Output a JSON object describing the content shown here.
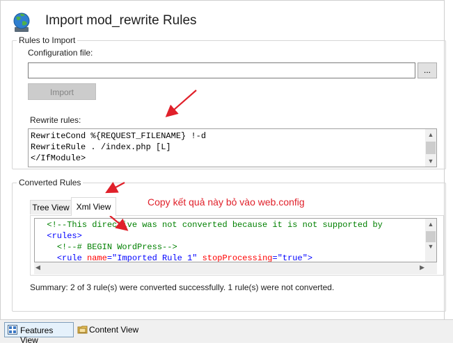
{
  "header": {
    "title": "Import mod_rewrite Rules",
    "icon": "globe-icon"
  },
  "rules_to_import": {
    "legend": "Rules to Import",
    "config_label": "Configuration file:",
    "config_value": "",
    "browse_label": "...",
    "import_label": "Import",
    "rewrite_label": "Rewrite rules:",
    "rewrite_lines": [
      "RewriteCond %{REQUEST_FILENAME} !-d",
      "RewriteRule . /index.php [L]",
      "</IfModule>"
    ]
  },
  "converted_rules": {
    "legend": "Converted Rules",
    "tabs": [
      {
        "label": "Tree View"
      },
      {
        "label": "Xml View"
      }
    ],
    "active_tab": "Xml View",
    "xml_lines": [
      {
        "indent": "  ",
        "parts": [
          {
            "t": "<!--This directive was not converted because it is not supported by",
            "c": "cmt"
          }
        ]
      },
      {
        "indent": "  ",
        "parts": [
          {
            "t": "<rules>",
            "c": "tag"
          }
        ]
      },
      {
        "indent": "    ",
        "parts": [
          {
            "t": "<!--# BEGIN WordPress-->",
            "c": "cmt"
          }
        ]
      },
      {
        "indent": "    ",
        "parts": [
          {
            "t": "<rule ",
            "c": "tag"
          },
          {
            "t": "name",
            "c": "attr"
          },
          {
            "t": "=",
            "c": "tag"
          },
          {
            "t": "\"Imported Rule 1\"",
            "c": "val"
          },
          {
            "t": " ",
            "c": "tag"
          },
          {
            "t": "stopProcessing",
            "c": "attr"
          },
          {
            "t": "=",
            "c": "tag"
          },
          {
            "t": "\"true\"",
            "c": "val"
          },
          {
            "t": ">",
            "c": "tag"
          }
        ]
      }
    ],
    "summary": "Summary: 2 of 3 rule(s) were converted successfully. 1 rule(s) were not converted."
  },
  "annotation": {
    "text": "Copy kết quả này bỏ vào web.config",
    "color": "#e0202a"
  },
  "statusbar": {
    "features_view": "Features View",
    "content_view": "Content View"
  }
}
